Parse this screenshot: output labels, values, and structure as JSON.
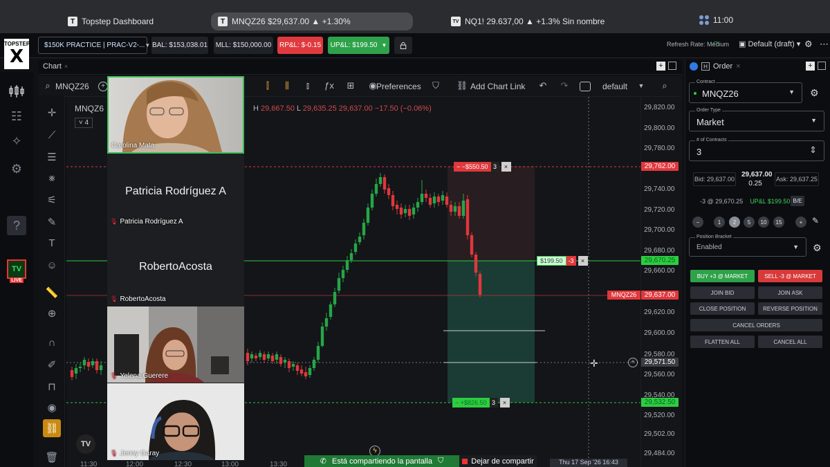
{
  "browser": {
    "tabs": [
      {
        "icon": "T",
        "label": "Topstep Dashboard"
      },
      {
        "icon": "T",
        "label": "MNQZ26 $29,637.00 ▲ +1.30%"
      },
      {
        "icon": "TV",
        "label": "NQ1! 29.637,00 ▲ +1.3% Sin nombre"
      }
    ],
    "clock": "11:00"
  },
  "header": {
    "logo_top": "TOPSTEP",
    "logo_letter": "X",
    "account": "$150K PRACTICE | PRAC-V2-...",
    "bal": "BAL: $153,038.01",
    "mll": "MLL: $150,000.00",
    "rpl": "RP&L: $-0.15",
    "upl": "UP&L: $199.50",
    "refresh": "Refresh Rate: Medium",
    "layout": "Default (draft)"
  },
  "sidebar": {
    "tv_label": "TV",
    "live_label": "LIVE"
  },
  "chart": {
    "tab_label": "Chart",
    "symbol_search": "MNQZ26",
    "preferences_label": "Preferences",
    "add_chart_link_label": "Add Chart Link",
    "template_label": "default",
    "symbol": "MNQZ6",
    "interval": "4",
    "ohlc": {
      "h_key": "H",
      "h": "29,667.50",
      "l_key": "L",
      "l": "29,635.25",
      "c": "29,637.00",
      "chg": "−17.50 (−0.06%)"
    },
    "price_labels": [
      "29,820.00",
      "29,800.00",
      "29,780.00",
      "29,740.00",
      "29,720.00",
      "29,700.00",
      "29,680.00",
      "29,660.00",
      "29,620.00",
      "29,600.00",
      "29,580.00",
      "29,560.00",
      "29,540.00",
      "29,520.00",
      "29,502.00",
      "29,484.00"
    ],
    "tags": {
      "stop": "29,762.00",
      "entry": "29,670.25",
      "last_symbol": "MNQZ26",
      "last": "29,637.00",
      "cursor": "29,571.50",
      "target": "29,532.50"
    },
    "brackets": {
      "stop_label": "− −$550.50",
      "stop_qty": "3",
      "pos_label": "$199.50",
      "pos_qty": "-3",
      "target_label": "− +$826.50",
      "target_qty": "3"
    },
    "time_labels": [
      "11:30",
      "12:00",
      "12:30",
      "13:00",
      "13:30"
    ],
    "time_tip": "Thu 17 Sep '26   16:43",
    "tv_logo": "TV"
  },
  "participants": [
    {
      "name": "Carolina Mata",
      "type": "video"
    },
    {
      "name": "Patricia Rodríguez A",
      "type": "name"
    },
    {
      "name": "RobertoAcosta",
      "type": "name"
    },
    {
      "name": "Yelena Guerere",
      "type": "video"
    },
    {
      "name": "Jenny Garay",
      "type": "video"
    }
  ],
  "share": {
    "status": "Está compartiendo la pantalla",
    "stop": "Dejar de compartir"
  },
  "order": {
    "tab_label": "Order",
    "contract_label": "Contract",
    "contract": "MNQZ26",
    "order_type_label": "Order Type",
    "order_type": "Market",
    "contracts_label": "# of Contracts",
    "contracts": "3",
    "bid": "Bid: 29,637.00",
    "mid_price": "29,637.00",
    "spread": "0.25",
    "ask": "Ask: 29,637.25",
    "position": "-3 @ 29,670.25",
    "position_upl": "UP&L $199.50",
    "be_label": "B/E",
    "quantities": [
      "−",
      "1",
      "2",
      "5",
      "10",
      "15",
      "+"
    ],
    "bracket_label": "Position Bracket",
    "bracket_value": "Enabled",
    "buy": "BUY +3 @ MARKET",
    "sell": "SELL -3 @ MARKET",
    "join_bid": "JOIN BID",
    "join_ask": "JOIN ASK",
    "close_position": "CLOSE POSITION",
    "reverse_position": "REVERSE POSITION",
    "cancel_orders": "CANCEL ORDERS",
    "flatten_all": "FLATTEN ALL",
    "cancel_all": "CANCEL ALL"
  },
  "colors": {
    "up": "#26a648",
    "down": "#e0383c",
    "accent": "#2ea24a"
  }
}
